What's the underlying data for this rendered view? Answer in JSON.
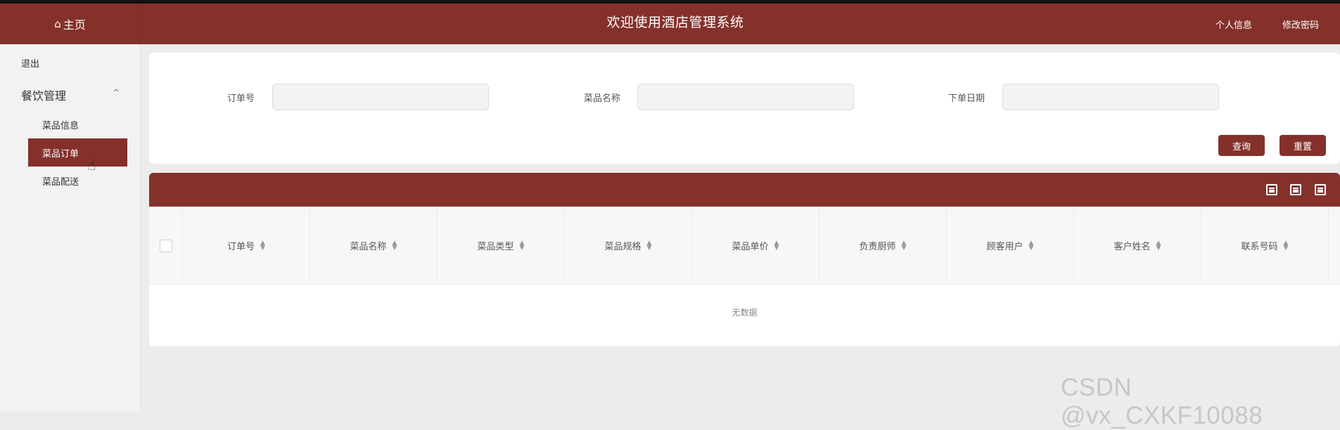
{
  "header": {
    "home_icon": "home-icon",
    "home_label": "主页",
    "title": "欢迎使用酒店管理系统",
    "profile_link": "个人信息",
    "password_link": "修改密码"
  },
  "sidebar": {
    "logout": "退出",
    "group_label": "餐饮管理",
    "group_chevron": "^",
    "items": [
      "菜品信息",
      "菜品订单",
      "菜品配送"
    ]
  },
  "search": {
    "order_no_label": "订单号",
    "order_no_value": "",
    "dish_name_label": "菜品名称",
    "dish_name_value": "",
    "order_date_label": "下单日期",
    "order_date_value": "",
    "query_button": "查询",
    "reset_button": "重置"
  },
  "table": {
    "columns": [
      "订单号",
      "菜品名称",
      "菜品类型",
      "菜品规格",
      "菜品单价",
      "负责厨师",
      "顾客用户",
      "客户姓名",
      "联系号码"
    ],
    "sort_glyph": "▲▼",
    "empty_text": "无数据",
    "toolbar_icons": [
      "calculator-icon",
      "save-icon",
      "print-icon"
    ]
  },
  "watermark": "CSDN @vx_CXKF10088",
  "colors": {
    "brand": "#84312b",
    "page_bg": "#ececec"
  }
}
